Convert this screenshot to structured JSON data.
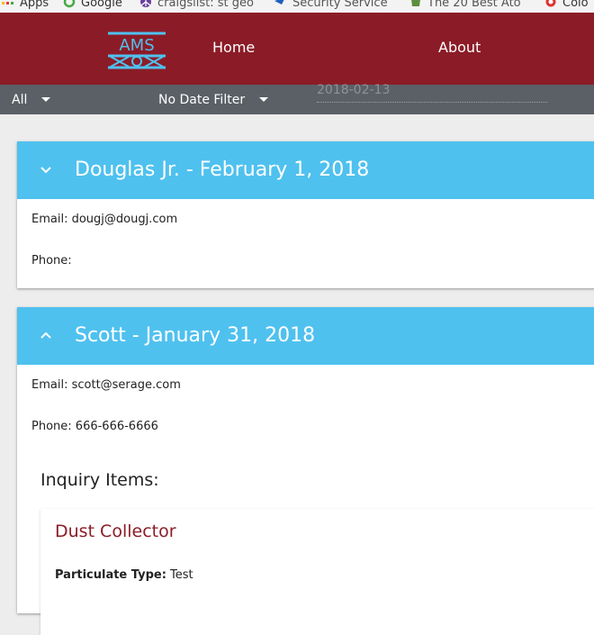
{
  "bookmarks": [
    {
      "label": "Apps",
      "icon": "apps-icon"
    },
    {
      "label": "Google",
      "icon": "google-icon"
    },
    {
      "label": "craigslist: st geo",
      "icon": "craigslist-icon"
    },
    {
      "label": "Security Service",
      "icon": "security-service-icon"
    },
    {
      "label": "The 20 Best Ato",
      "icon": "shopify-icon"
    },
    {
      "label": "Colo",
      "icon": "colo-icon"
    }
  ],
  "header": {
    "logo_text": "AMS",
    "nav": {
      "home": "Home",
      "about": "About"
    }
  },
  "filters": {
    "status": "All",
    "date_filter": "No Date Filter",
    "date_value": "2018-02-13"
  },
  "inquiries": [
    {
      "title": "Douglas Jr. - February 1, 2018",
      "expanded": false,
      "email_label": "Email:",
      "email": "dougj@dougj.com",
      "phone_label": "Phone:",
      "phone": ""
    },
    {
      "title": "Scott - January 31, 2018",
      "expanded": true,
      "email_label": "Email:",
      "email": "scott@serage.com",
      "phone_label": "Phone:",
      "phone": "666-666-6666",
      "items_heading": "Inquiry Items:",
      "items": [
        {
          "title": "Dust Collector",
          "particulate_label": "Particulate Type:",
          "particulate_value": "Test"
        }
      ]
    }
  ],
  "colors": {
    "appbar": "#8b1c27",
    "filterbar": "#5a6066",
    "card_header": "#4fc1ef",
    "item_title": "#8b1c27"
  }
}
